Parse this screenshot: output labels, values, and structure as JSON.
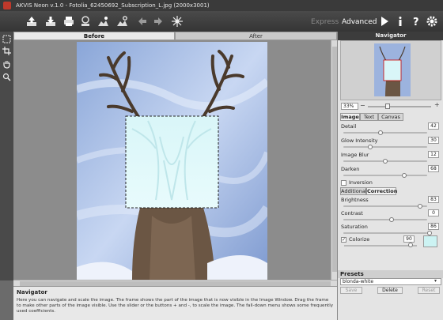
{
  "window": {
    "title": "AKVIS Neon v.1.0 - Fotolia_62450692_Subscription_L.jpg (2000x3001)"
  },
  "toolbar": {
    "mode_express": "Express",
    "mode_advanced": "Advanced"
  },
  "view_tabs": {
    "before": "Before",
    "after": "After"
  },
  "navigator": {
    "title": "Navigator",
    "zoom": "33%"
  },
  "param_tabs": [
    "Image",
    "Text",
    "Canvas"
  ],
  "image_params": [
    {
      "label": "Detail",
      "value": "42",
      "fraction": 0.42
    },
    {
      "label": "Glow Intensity",
      "value": "30",
      "fraction": 0.3
    },
    {
      "label": "Image Blur",
      "value": "12",
      "fraction": 0.12
    },
    {
      "label": "Darken",
      "value": "68",
      "fraction": 0.68
    }
  ],
  "inversion_label": "Inversion",
  "sub_tabs": [
    "Additional",
    "Correction"
  ],
  "correction_params": [
    {
      "label": "Brightness",
      "value": "83",
      "fraction": 0.83
    },
    {
      "label": "Contrast",
      "value": "0",
      "fraction": 0.5
    },
    {
      "label": "Saturation",
      "value": "86",
      "fraction": 0.86
    }
  ],
  "colorize": {
    "label": "Colorize",
    "value": "90",
    "fraction": 0.9,
    "color": "#ccf3f3"
  },
  "presets": {
    "title": "Presets",
    "selected": "blonda-white",
    "save": "Save",
    "delete": "Delete",
    "reset": "Reset"
  },
  "help": {
    "title": "Navigator",
    "text": "Here you can navigate and scale the image. The frame shows the part of the image that is now visible in the Image Window. Drag the frame to make other parts of the image visible. Use the slider or the buttons + and -, to scale the image. The fall-down menu shows some frequently used coefficients."
  },
  "colors": {
    "accent": "#3a3a3a",
    "panel": "#e4e4e4"
  }
}
